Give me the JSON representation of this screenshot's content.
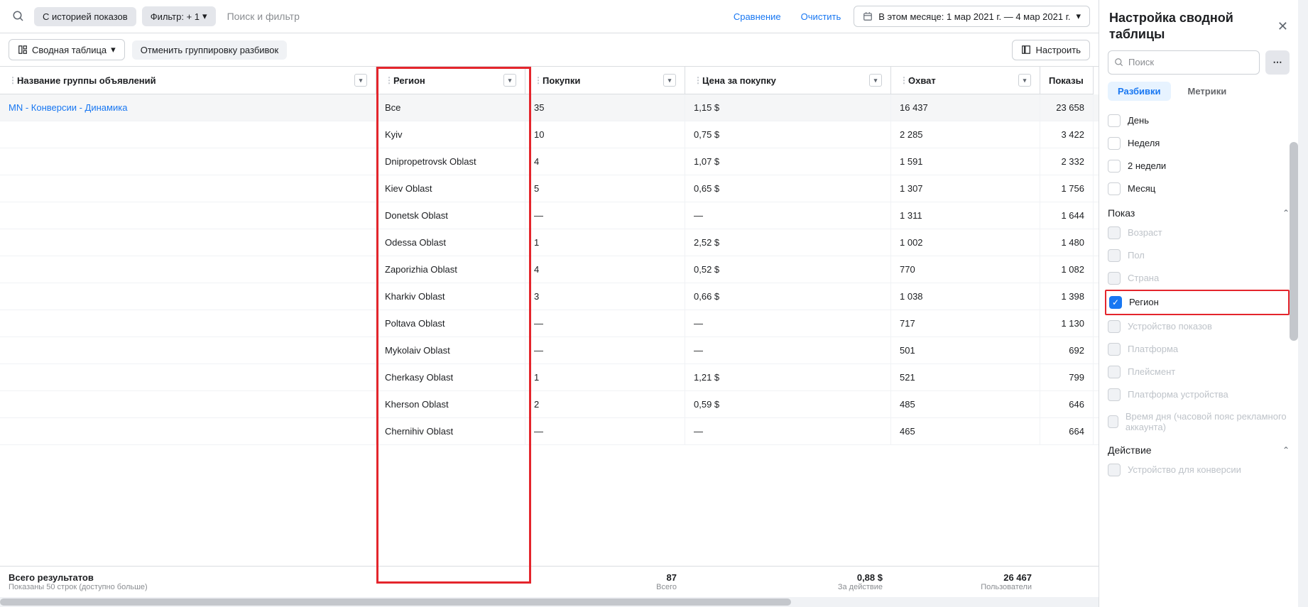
{
  "toolbar": {
    "history_pill": "С историей показов",
    "filter_pill": "Фильтр: + 1",
    "search_placeholder": "Поиск и фильтр",
    "compare": "Сравнение",
    "clear": "Очистить",
    "date_range": "В этом месяце: 1 мар 2021 г. — 4 мар 2021 г.",
    "pivot_btn": "Сводная таблица",
    "ungroup_btn": "Отменить группировку разбивок",
    "customize_btn": "Настроить"
  },
  "columns": {
    "name": "Название группы объявлений",
    "region": "Регион",
    "purchases": "Покупки",
    "cost": "Цена за покупку",
    "reach": "Охват",
    "impressions": "Показы"
  },
  "adset_name": "MN - Конверсии - Динамика",
  "rows": [
    {
      "region": "Все",
      "buy": "35",
      "cost": "1,15 $",
      "reach": "16 437",
      "impr": "23 658",
      "hl": true
    },
    {
      "region": "Kyiv",
      "buy": "10",
      "cost": "0,75 $",
      "reach": "2 285",
      "impr": "3 422"
    },
    {
      "region": "Dnipropetrovsk Oblast",
      "buy": "4",
      "cost": "1,07 $",
      "reach": "1 591",
      "impr": "2 332"
    },
    {
      "region": "Kiev Oblast",
      "buy": "5",
      "cost": "0,65 $",
      "reach": "1 307",
      "impr": "1 756"
    },
    {
      "region": "Donetsk Oblast",
      "buy": "—",
      "cost": "—",
      "reach": "1 311",
      "impr": "1 644"
    },
    {
      "region": "Odessa Oblast",
      "buy": "1",
      "cost": "2,52 $",
      "reach": "1 002",
      "impr": "1 480"
    },
    {
      "region": "Zaporizhia Oblast",
      "buy": "4",
      "cost": "0,52 $",
      "reach": "770",
      "impr": "1 082"
    },
    {
      "region": "Kharkiv Oblast",
      "buy": "3",
      "cost": "0,66 $",
      "reach": "1 038",
      "impr": "1 398"
    },
    {
      "region": "Poltava Oblast",
      "buy": "—",
      "cost": "—",
      "reach": "717",
      "impr": "1 130"
    },
    {
      "region": "Mykolaiv Oblast",
      "buy": "—",
      "cost": "—",
      "reach": "501",
      "impr": "692"
    },
    {
      "region": "Cherkasy Oblast",
      "buy": "1",
      "cost": "1,21 $",
      "reach": "521",
      "impr": "799"
    },
    {
      "region": "Kherson Oblast",
      "buy": "2",
      "cost": "0,59 $",
      "reach": "485",
      "impr": "646"
    },
    {
      "region": "Chernihiv Oblast",
      "buy": "—",
      "cost": "—",
      "reach": "465",
      "impr": "664"
    }
  ],
  "totals": {
    "label": "Всего результатов",
    "sub": "Показаны 50 строк (доступно больше)",
    "buy": "87",
    "buy_sub": "Всего",
    "cost": "0,88 $",
    "cost_sub": "За действие",
    "reach": "26 467",
    "reach_sub": "Пользователи"
  },
  "sidebar": {
    "title": "Настройка сводной таблицы",
    "search_ph": "Поиск",
    "tabs": {
      "breakdowns": "Разбивки",
      "metrics": "Метрики"
    },
    "time_opts": [
      "День",
      "Неделя",
      "2 недели",
      "Месяц"
    ],
    "section_delivery": "Показ",
    "delivery_opts": [
      {
        "label": "Возраст",
        "disabled": true
      },
      {
        "label": "Пол",
        "disabled": true
      },
      {
        "label": "Страна",
        "disabled": true
      },
      {
        "label": "Регион",
        "checked": true,
        "highlight": true
      },
      {
        "label": "Устройство показов",
        "disabled": true
      },
      {
        "label": "Платформа",
        "disabled": true
      },
      {
        "label": "Плейсмент",
        "disabled": true
      },
      {
        "label": "Платформа устройства",
        "disabled": true
      },
      {
        "label": "Время дня (часовой пояс рекламного аккаунта)",
        "disabled": true
      }
    ],
    "section_action": "Действие",
    "action_opts": [
      {
        "label": "Устройство для конверсии",
        "disabled": true
      }
    ]
  }
}
